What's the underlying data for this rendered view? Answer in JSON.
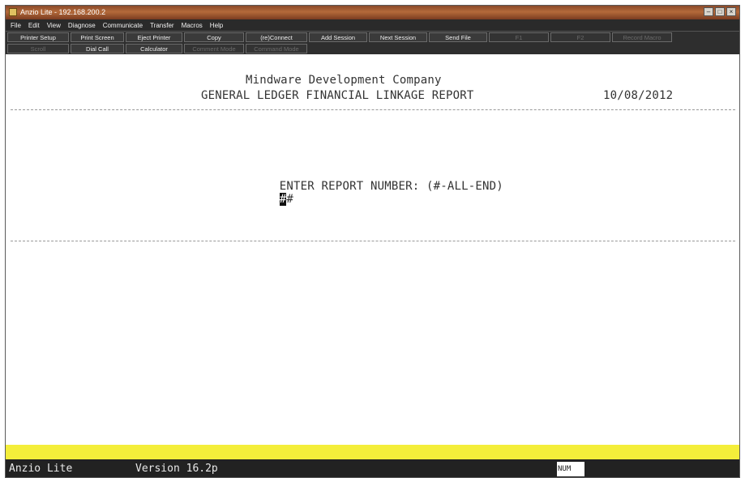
{
  "window": {
    "title": "Anzio Lite - 192.168.200.2"
  },
  "menu": [
    "File",
    "Edit",
    "View",
    "Diagnose",
    "Communicate",
    "Transfer",
    "Macros",
    "Help"
  ],
  "toolbar_row1": [
    {
      "label": "Printer Setup",
      "enabled": true
    },
    {
      "label": "Print Screen",
      "enabled": true
    },
    {
      "label": "Eject Printer",
      "enabled": true
    },
    {
      "label": "Copy",
      "enabled": true
    },
    {
      "label": "(re)Connect",
      "enabled": true
    },
    {
      "label": "Add Session",
      "enabled": true
    },
    {
      "label": "Next Session",
      "enabled": true
    },
    {
      "label": "Send File",
      "enabled": true
    },
    {
      "label": "F1",
      "enabled": false
    },
    {
      "label": "F2",
      "enabled": false
    },
    {
      "label": "Record Macro",
      "enabled": false
    }
  ],
  "toolbar_row2": [
    {
      "label": "Scroll",
      "enabled": false
    },
    {
      "label": "Dial Call",
      "enabled": true
    },
    {
      "label": "Calculator",
      "enabled": true
    },
    {
      "label": "Comment Mode",
      "enabled": false
    },
    {
      "label": "Command Mode",
      "enabled": false
    }
  ],
  "screen": {
    "company": "Mindware Development Company",
    "report_title": "GENERAL LEDGER FINANCIAL LINKAGE REPORT",
    "date": "10/08/2012",
    "prompt": "ENTER REPORT NUMBER: (#-ALL-END)",
    "cursor_char": "#",
    "input_value": "#"
  },
  "status": {
    "app_name": "Anzio Lite",
    "version": "Version 16.2p",
    "num_indicator": "NUM"
  }
}
